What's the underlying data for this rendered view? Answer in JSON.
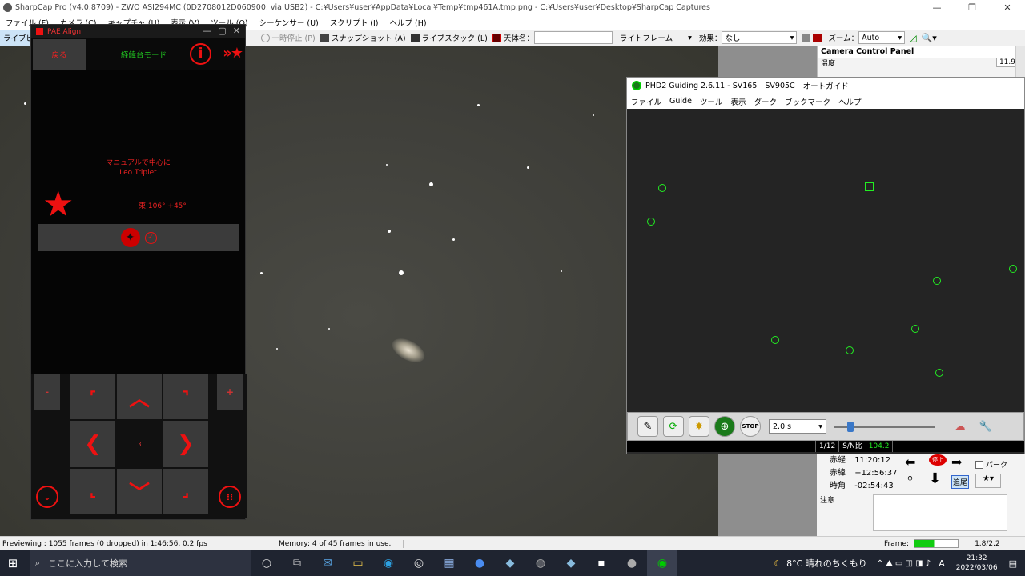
{
  "sharpcap": {
    "title": "SharpCap Pro (v4.0.8709) - ZWO ASI294MC (0D2708012D060900, via USB2) - C:¥Users¥user¥AppData¥Local¥Temp¥tmp461A.tmp.png - C:¥Users¥user¥Desktop¥SharpCap Captures",
    "menu": [
      "ファイル (F)",
      "カメラ (C)",
      "キャプチャ (U)",
      "表示 (V)",
      "ツール (O)",
      "シーケンサー (U)",
      "スクリプト (I)",
      "ヘルプ (H)"
    ],
    "toolbar": {
      "left_label": "ライブビュ",
      "pause": "一時停止 (P)",
      "snapshot": "スナップショット (A)",
      "livestack": "ライブスタック (L)",
      "target_label": "天体名：",
      "frame_type": "ライトフレーム",
      "effect_label": "効果：",
      "effect_value": "なし",
      "zoom_label": "ズーム：",
      "zoom_value": "Auto"
    },
    "ccp": {
      "title": "Camera Control Panel",
      "temp_label": "温度",
      "temp_value": "11.9"
    },
    "status_left": "Previewing : 1055 frames (0 dropped) in 1:46:56, 0.2 fps",
    "status_mid": "Memory: 4 of 45 frames in use.",
    "frame_label": "Frame:",
    "frame_value": "1.8/2.2"
  },
  "pae": {
    "title": "PAE Align",
    "back": "戻る",
    "mode": "経緯台モード",
    "target_line1": "マニュアルで中心に",
    "target_line2": "Leo Triplet",
    "coord": "東 106° +45°",
    "pad_center": "3",
    "minus": "-",
    "plus": "+"
  },
  "phd2": {
    "title": "PHD2 Guiding 2.6.11 - SV165",
    "camera": "SV905C",
    "mode": "オートガイド",
    "menu": [
      "ファイル",
      "Guide",
      "ツール",
      "表示",
      "ダーク",
      "ブックマーク",
      "ヘルプ"
    ],
    "exposure": "2.0 s",
    "status_frame": "1/12",
    "snr_label": "S/N比",
    "snr_value": "104.2"
  },
  "telescope": {
    "ra_label": "赤経",
    "ra_value": "11:20:12",
    "dec_label": "赤緯",
    "dec_value": "+12:56:37",
    "ha_label": "時角",
    "ha_value": "-02:54:43",
    "park_label": "パーク",
    "track_label": "追尾",
    "stop_label": "停止",
    "notes_label": "注意"
  },
  "taskbar": {
    "search_placeholder": "ここに入力して検索",
    "weather": "8°C  晴れのちくもり",
    "ime": "A",
    "time": "21:32",
    "date": "2022/03/06"
  }
}
